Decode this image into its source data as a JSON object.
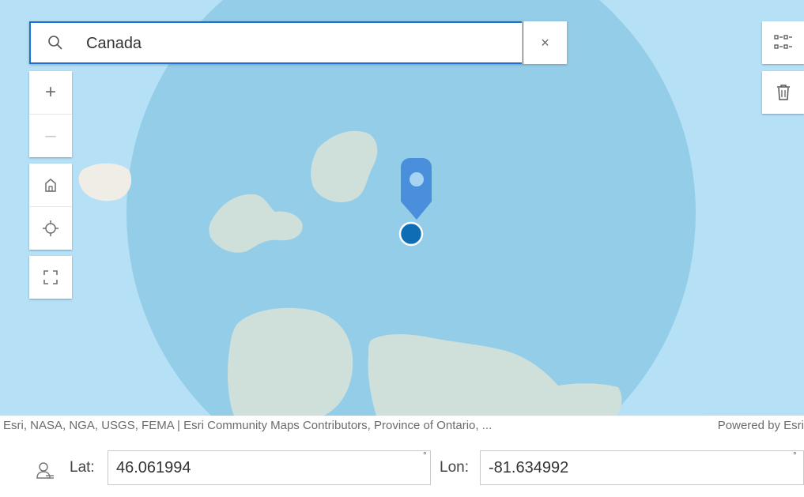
{
  "search": {
    "value": "Canada",
    "search_icon": "search-icon",
    "clear_label": "×"
  },
  "zoom": {
    "in_label": "+",
    "out_label": "–"
  },
  "map_tools": {
    "home_icon": "home-icon",
    "locate_icon": "locate-icon",
    "fullscreen_icon": "fullscreen-icon",
    "layers_icon": "grid-list-icon",
    "delete_icon": "trash-icon"
  },
  "attribution": {
    "sources": "Esri, NASA, NGA, USGS, FEMA | Esri Community Maps Contributors, Province of Ontario, ...",
    "powered_by": "Powered by Esri"
  },
  "coordinates": {
    "lat_label": "Lat:",
    "lat_value": "46.061994",
    "lat_unit": "°",
    "lon_label": "Lon:",
    "lon_value": "-81.634992",
    "lon_unit": "°"
  },
  "colors": {
    "water": "#b5e0f6",
    "buffer_circle": "#94cde8",
    "land": "#cfdfd9",
    "marker": "#4a8fdc",
    "point": "#0e6db4",
    "focus_border": "#1f6fd0"
  }
}
